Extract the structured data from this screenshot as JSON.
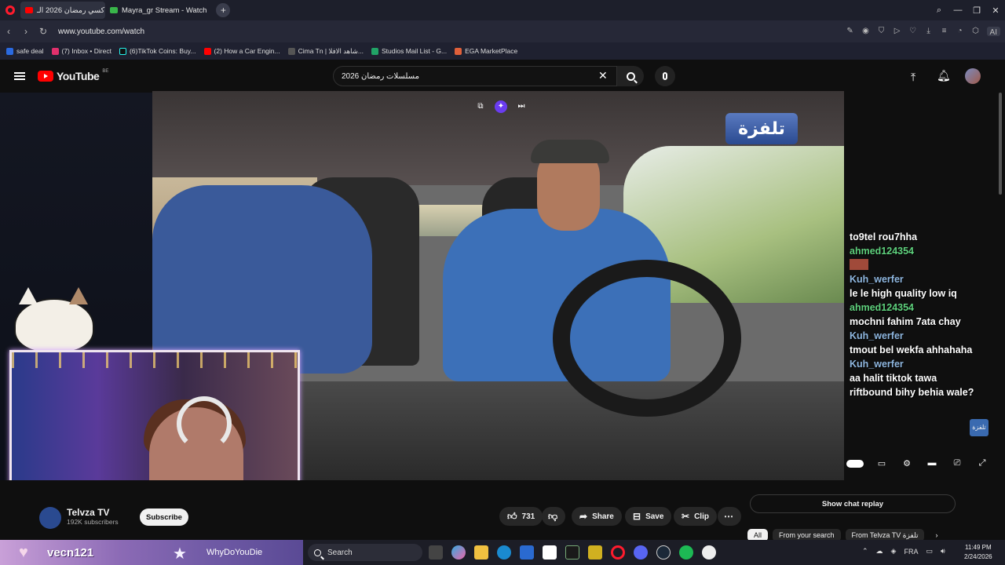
{
  "browser": {
    "tabs": [
      {
        "label": "تاكسي رمضان 2026 الـ",
        "active": true
      },
      {
        "label": "Mayra_gr Stream - Watch",
        "active": false
      }
    ],
    "url": "www.youtube.com/watch",
    "ai_label": "AI",
    "bookmarks": [
      "safe deal",
      "(7) Inbox • Direct",
      "(6)TikTok Coins: Buy...",
      "(2) How a Car Engin...",
      "Cima Tn | شاهد الافلا...",
      "Studios Mail List - G...",
      "EGA MarketPlace"
    ]
  },
  "youtube": {
    "logo": "YouTube",
    "country": "BE",
    "search_value": "مسلسلات رمضان 2026",
    "video": {
      "channel_watermark": "تلفزة"
    },
    "chat": {
      "messages": [
        {
          "user": "",
          "text": "to9tel rou7hha"
        },
        {
          "user": "ahmed124354",
          "text": ""
        },
        {
          "user": "Kuh_werfer",
          "text": "le le high quality low iq"
        },
        {
          "user": "ahmed124354",
          "text": "mochni fahim 7ata chay"
        },
        {
          "user": "Kuh_werfer",
          "text": "tmout bel wekfa ahhahaha"
        },
        {
          "user": "Kuh_werfer",
          "text": "aa halit tiktok tawa"
        },
        {
          "user": "",
          "text": "riftbound bihy behia wale?"
        }
      ],
      "badge": "تلفزة"
    },
    "channel": {
      "name": "Telvza TV",
      "subscribers": "192K subscribers",
      "subscribe_label": "Subscribe"
    },
    "actions": {
      "likes": "731",
      "share": "Share",
      "save": "Save",
      "clip": "Clip"
    },
    "show_chat_replay": "Show chat replay",
    "chips": [
      "All",
      "From your search",
      "From Telvza TV تلفزة"
    ]
  },
  "stream_overlay": {
    "viewer1": "vecn121",
    "viewer2": "WhyDoYouDie"
  },
  "taskbar": {
    "search_placeholder": "Search",
    "lang": "FRA",
    "time": "11:49 PM",
    "date": "2/24/2026"
  }
}
